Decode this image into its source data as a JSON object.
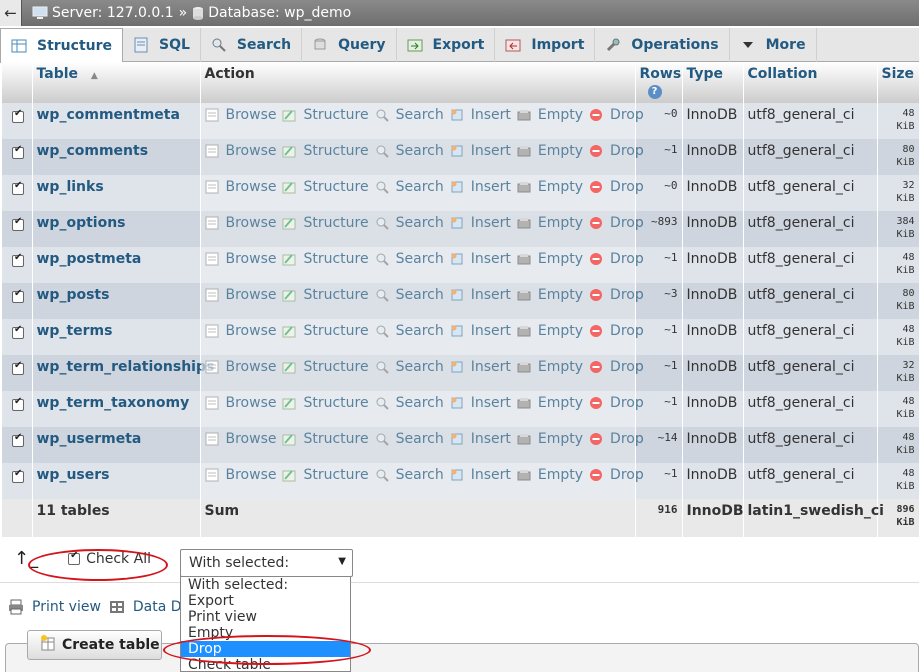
{
  "breadcrumb": {
    "back": "←",
    "server": "Server: 127.0.0.1",
    "sep": "»",
    "database": "Database: wp_demo"
  },
  "tabs": [
    {
      "label": "Structure",
      "icon": "structure-icon"
    },
    {
      "label": "SQL",
      "icon": "sql-icon"
    },
    {
      "label": "Search",
      "icon": "search-icon"
    },
    {
      "label": "Query",
      "icon": "query-icon"
    },
    {
      "label": "Export",
      "icon": "export-icon"
    },
    {
      "label": "Import",
      "icon": "import-icon"
    },
    {
      "label": "Operations",
      "icon": "wrench-icon"
    },
    {
      "label": "More",
      "icon": "chevron-down-icon"
    }
  ],
  "table": {
    "headers": {
      "table": "Table",
      "sort": "▲",
      "action": "Action",
      "rows": "Rows",
      "type": "Type",
      "collation": "Collation",
      "size": "Size"
    },
    "actions": [
      "Browse",
      "Structure",
      "Search",
      "Insert",
      "Empty",
      "Drop"
    ],
    "rows": [
      {
        "name": "wp_commentmeta",
        "rows": "~0",
        "type": "InnoDB",
        "collation": "utf8_general_ci",
        "size_num": "48",
        "size_unit": "KiB"
      },
      {
        "name": "wp_comments",
        "rows": "~1",
        "type": "InnoDB",
        "collation": "utf8_general_ci",
        "size_num": "80",
        "size_unit": "KiB"
      },
      {
        "name": "wp_links",
        "rows": "~0",
        "type": "InnoDB",
        "collation": "utf8_general_ci",
        "size_num": "32",
        "size_unit": "KiB"
      },
      {
        "name": "wp_options",
        "rows": "~893",
        "type": "InnoDB",
        "collation": "utf8_general_ci",
        "size_num": "384",
        "size_unit": "KiB"
      },
      {
        "name": "wp_postmeta",
        "rows": "~1",
        "type": "InnoDB",
        "collation": "utf8_general_ci",
        "size_num": "48",
        "size_unit": "KiB"
      },
      {
        "name": "wp_posts",
        "rows": "~3",
        "type": "InnoDB",
        "collation": "utf8_general_ci",
        "size_num": "80",
        "size_unit": "KiB"
      },
      {
        "name": "wp_terms",
        "rows": "~1",
        "type": "InnoDB",
        "collation": "utf8_general_ci",
        "size_num": "48",
        "size_unit": "KiB"
      },
      {
        "name": "wp_term_relationships",
        "rows": "~1",
        "type": "InnoDB",
        "collation": "utf8_general_ci",
        "size_num": "32",
        "size_unit": "KiB"
      },
      {
        "name": "wp_term_taxonomy",
        "rows": "~1",
        "type": "InnoDB",
        "collation": "utf8_general_ci",
        "size_num": "48",
        "size_unit": "KiB"
      },
      {
        "name": "wp_usermeta",
        "rows": "~14",
        "type": "InnoDB",
        "collation": "utf8_general_ci",
        "size_num": "48",
        "size_unit": "KiB"
      },
      {
        "name": "wp_users",
        "rows": "~1",
        "type": "InnoDB",
        "collation": "utf8_general_ci",
        "size_num": "48",
        "size_unit": "KiB"
      }
    ],
    "footer": {
      "count": "11 tables",
      "sum": "Sum",
      "rows": "916",
      "type": "InnoDB",
      "collation": "latin1_swedish_ci",
      "size_num": "896",
      "size_unit": "KiB"
    }
  },
  "bottom": {
    "arrow": "↑_",
    "check_all": "Check All",
    "with_selected": "With selected:",
    "select_arrow": "▼",
    "options": [
      "With selected:",
      "Export",
      "Print view",
      "Empty",
      "Drop",
      "Check table"
    ],
    "selected_option": "Drop",
    "print_view": "Print view",
    "data_dict": "Data Dict",
    "create_table": "Create table"
  },
  "colors": {
    "link": "#235a81",
    "highlight": "#1e90ff",
    "annotation": "#d4141b"
  }
}
